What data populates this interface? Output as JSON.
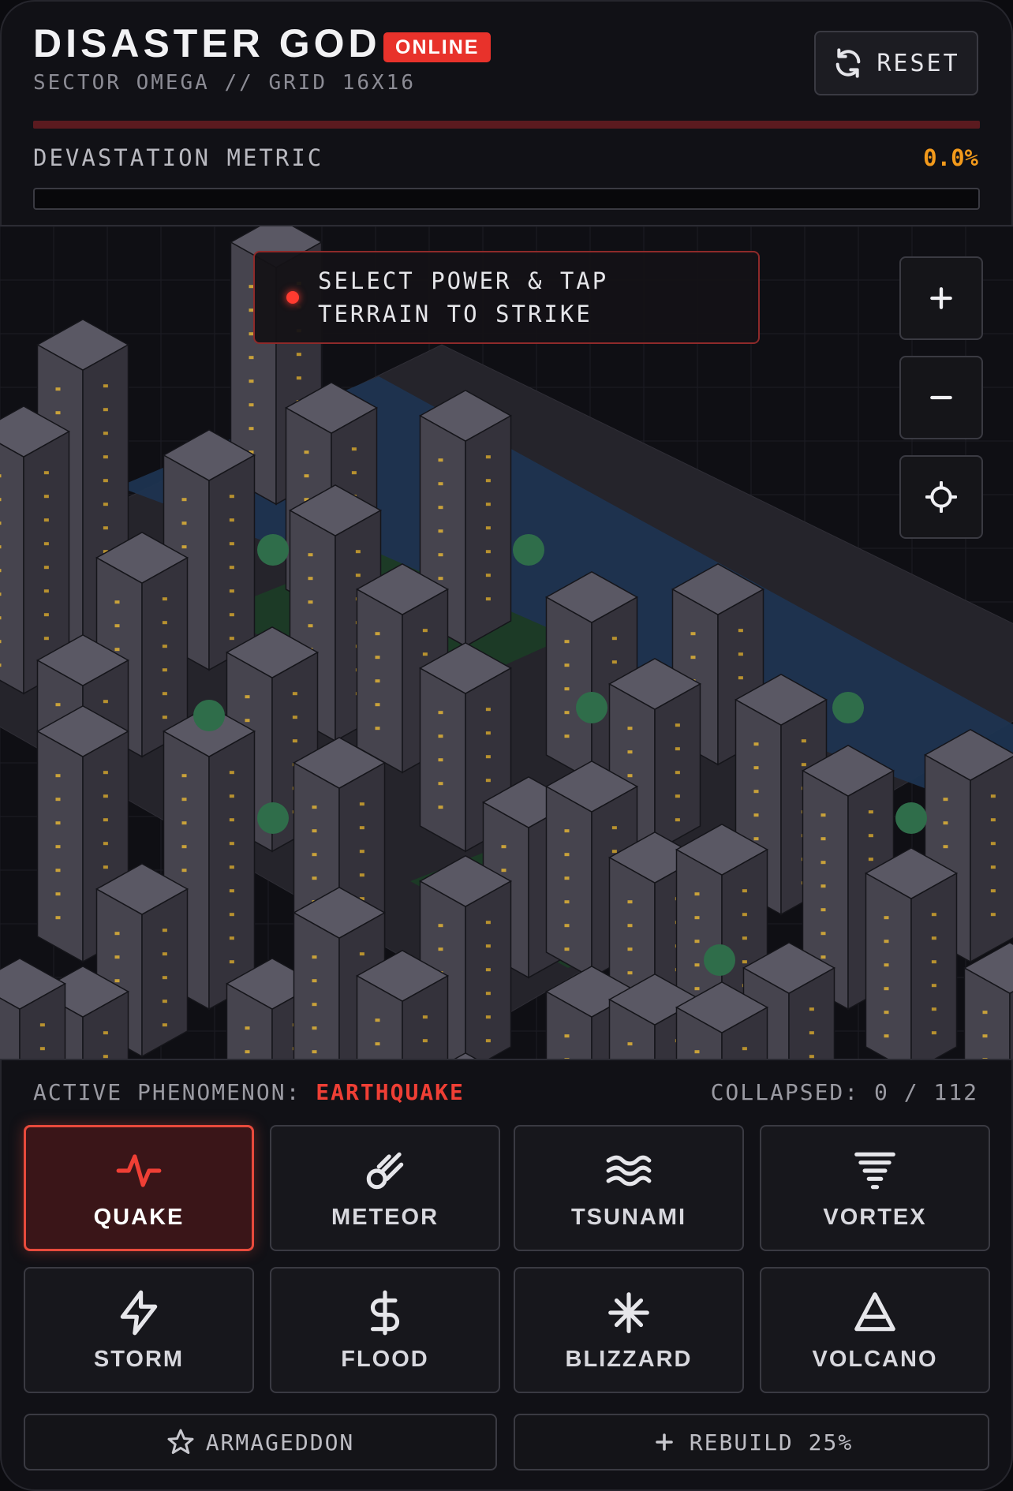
{
  "header": {
    "title": "DISASTER GOD",
    "status_badge": "ONLINE",
    "subtitle": "SECTOR OMEGA // GRID 16X16",
    "reset_label": "RESET"
  },
  "metric": {
    "label": "DEVASTATION METRIC",
    "value": "0.0%",
    "fraction": 0.0
  },
  "map": {
    "hint": "SELECT POWER & TAP TERRAIN TO STRIKE",
    "controls": [
      "zoom-in",
      "zoom-out",
      "recenter"
    ]
  },
  "panel": {
    "active_prefix": "ACTIVE PHENOMENON:",
    "active_value": "EARTHQUAKE",
    "collapsed": "COLLAPSED: 0 / 112",
    "powers": [
      {
        "label": "QUAKE",
        "icon": "activity-icon",
        "active": true
      },
      {
        "label": "METEOR",
        "icon": "meteor-icon",
        "active": false
      },
      {
        "label": "TSUNAMI",
        "icon": "waves-icon",
        "active": false
      },
      {
        "label": "VORTEX",
        "icon": "tornado-icon",
        "active": false
      },
      {
        "label": "STORM",
        "icon": "lightning-icon",
        "active": false
      },
      {
        "label": "FLOOD",
        "icon": "dollar-icon",
        "active": false
      },
      {
        "label": "BLIZZARD",
        "icon": "snowflake-icon",
        "active": false
      },
      {
        "label": "VOLCANO",
        "icon": "triangle-icon",
        "active": false
      }
    ],
    "armageddon_label": "ARMAGEDDON",
    "rebuild_label": "REBUILD 25%"
  },
  "colors": {
    "accent_red": "#e8322b",
    "metric_orange": "#f39a1b",
    "water": "#1d3450",
    "grass": "#1c3a26",
    "building": "#4a4852"
  }
}
